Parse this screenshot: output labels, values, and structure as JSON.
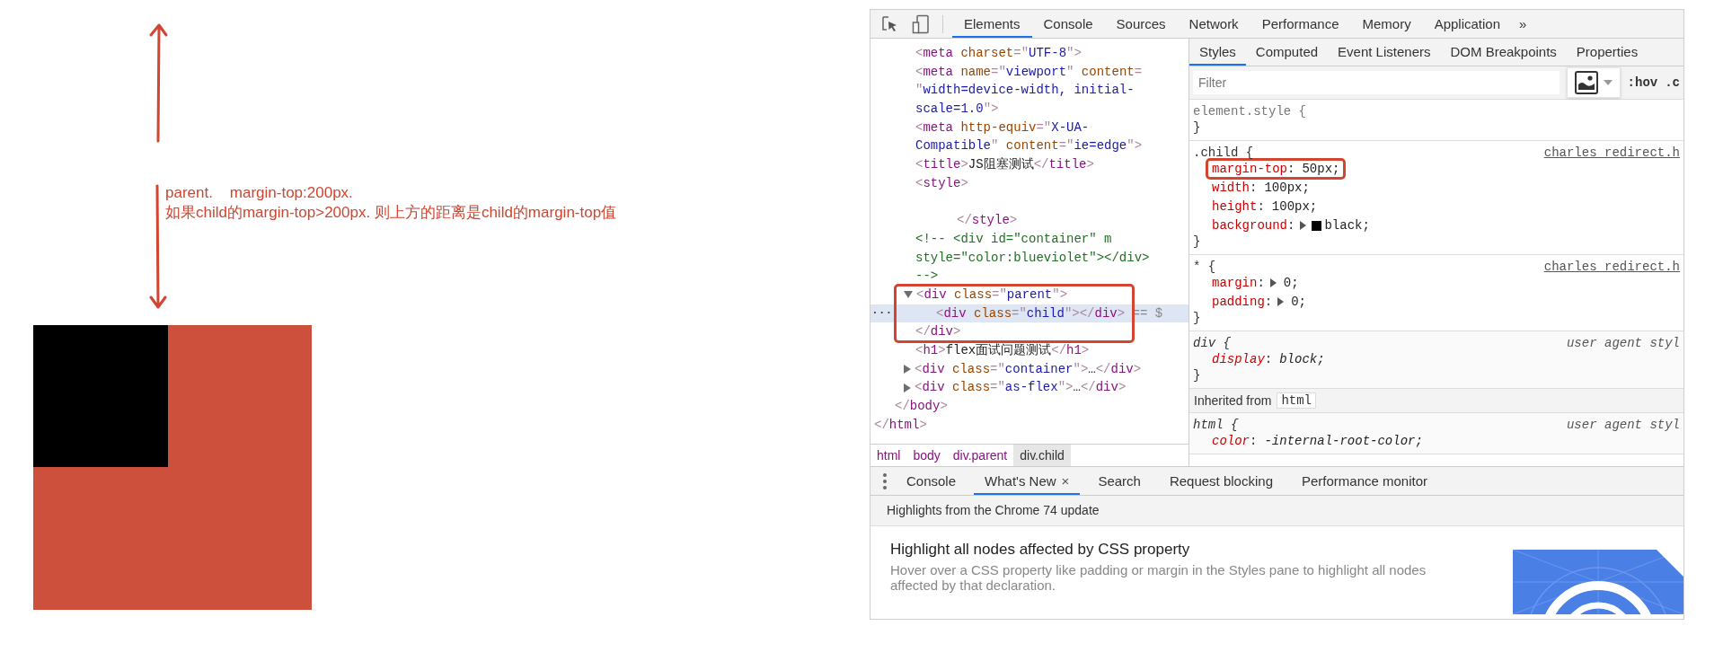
{
  "annotation": {
    "lines": [
      "parent.    margin-top:200px.",
      "如果child的margin-top>200px. 则上方的距离是child的margin-top值"
    ]
  },
  "devtools": {
    "toolbar": {
      "tabs": [
        {
          "label": "Elements",
          "selected": true
        },
        {
          "label": "Console",
          "selected": false
        },
        {
          "label": "Sources",
          "selected": false
        },
        {
          "label": "Network",
          "selected": false
        },
        {
          "label": "Performance",
          "selected": false
        },
        {
          "label": "Memory",
          "selected": false
        },
        {
          "label": "Application",
          "selected": false
        }
      ],
      "overflow": "»"
    },
    "dom_tree": [
      {
        "closing": [
          {
            "p": "</"
          },
          {
            "tag": "html"
          },
          {
            "p": ">"
          }
        ],
        "children": [
          {
            "closing": [
              {
                "p": "</"
              },
              {
                "tag": "body"
              },
              {
                "p": ">"
              }
            ],
            "children": [
              {
                "selected": false,
                "highlighted": false,
                "lines": [
                  [
                    {
                      "p": "<"
                    },
                    {
                      "tag": "meta"
                    },
                    {
                      "attr": " charset"
                    },
                    {
                      "p": "=\""
                    },
                    {
                      "val": "UTF-8"
                    },
                    {
                      "p": "\">"
                    }
                  ]
                ]
              },
              {
                "selected": false,
                "highlighted": false,
                "lines": [
                  [
                    {
                      "p": "<"
                    },
                    {
                      "tag": "meta"
                    },
                    {
                      "attr": " name"
                    },
                    {
                      "p": "=\""
                    },
                    {
                      "val": "viewport"
                    },
                    {
                      "p": "\""
                    },
                    {
                      "attr": " content"
                    },
                    {
                      "p": "="
                    }
                  ],
                  [
                    {
                      "p": "\""
                    },
                    {
                      "val": "width=device-width, initial-"
                    }
                  ],
                  [
                    {
                      "val": "scale=1.0"
                    },
                    {
                      "p": "\">"
                    }
                  ]
                ]
              },
              {
                "selected": false,
                "highlighted": false,
                "lines": [
                  [
                    {
                      "p": "<"
                    },
                    {
                      "tag": "meta"
                    },
                    {
                      "attr": " http-equiv"
                    },
                    {
                      "p": "=\""
                    },
                    {
                      "val": "X-UA-"
                    }
                  ],
                  [
                    {
                      "val": "Compatible"
                    },
                    {
                      "p": "\""
                    },
                    {
                      "attr": " content"
                    },
                    {
                      "p": "=\""
                    },
                    {
                      "val": "ie=edge"
                    },
                    {
                      "p": "\">"
                    }
                  ]
                ]
              },
              {
                "selected": false,
                "highlighted": false,
                "lines": [
                  [
                    {
                      "p": "<"
                    },
                    {
                      "tag": "title"
                    },
                    {
                      "p": ">"
                    },
                    {
                      "text": "JS阻塞测试"
                    },
                    {
                      "p": "</"
                    },
                    {
                      "tag": "title"
                    },
                    {
                      "p": ">"
                    }
                  ]
                ]
              },
              {
                "kind": "raw-text",
                "selected": false,
                "highlighted": false,
                "lines": [
                  [
                    {
                      "p": "<"
                    },
                    {
                      "tag": "style"
                    },
                    {
                      "p": ">"
                    }
                  ]
                ],
                "closing": [
                  {
                    "p": "</"
                  },
                  {
                    "tag": "style"
                  },
                  {
                    "p": ">"
                  }
                ]
              },
              {
                "kind": "comment",
                "selected": false,
                "highlighted": false,
                "lines": [
                  [
                    {
                      "c": "<!-- <div id=\"container\" m"
                    }
                  ],
                  [
                    {
                      "c": "style=\"color:blueviolet\"></div>"
                    }
                  ],
                  [
                    {
                      "c": "-->"
                    }
                  ]
                ]
              },
              {
                "selected": false,
                "highlighted": true,
                "expanded": true,
                "lines": [
                  [
                    {
                      "p": "<"
                    },
                    {
                      "tag": "div"
                    },
                    {
                      "attr": " class"
                    },
                    {
                      "p": "=\""
                    },
                    {
                      "val": "parent"
                    },
                    {
                      "p": "\">"
                    }
                  ]
                ],
                "closing": [
                  {
                    "p": "</"
                  },
                  {
                    "tag": "div"
                  },
                  {
                    "p": ">"
                  }
                ],
                "children": [
                  {
                    "selected": true,
                    "highlighted": false,
                    "gutter": "...",
                    "suffix": "== $",
                    "lines": [
                      [
                        {
                          "p": "<"
                        },
                        {
                          "tag": "div"
                        },
                        {
                          "attr": " class"
                        },
                        {
                          "p": "=\""
                        },
                        {
                          "val": "child"
                        },
                        {
                          "p": "\"></"
                        },
                        {
                          "tag": "div"
                        },
                        {
                          "p": ">"
                        }
                      ]
                    ]
                  }
                ]
              },
              {
                "selected": false,
                "highlighted": false,
                "lines": [
                  [
                    {
                      "p": "<"
                    },
                    {
                      "tag": "h1"
                    },
                    {
                      "p": ">"
                    },
                    {
                      "text": "flex面试问题测试"
                    },
                    {
                      "p": "</"
                    },
                    {
                      "tag": "h1"
                    },
                    {
                      "p": ">"
                    }
                  ]
                ]
              },
              {
                "selected": false,
                "highlighted": false,
                "expanded": false,
                "lines": [
                  [
                    {
                      "p": "<"
                    },
                    {
                      "tag": "div"
                    },
                    {
                      "attr": " class"
                    },
                    {
                      "p": "=\""
                    },
                    {
                      "val": "container"
                    },
                    {
                      "p": "\">"
                    },
                    {
                      "text": "…"
                    },
                    {
                      "p": "</"
                    },
                    {
                      "tag": "div"
                    },
                    {
                      "p": ">"
                    }
                  ]
                ]
              },
              {
                "selected": false,
                "highlighted": false,
                "expanded": false,
                "lines": [
                  [
                    {
                      "p": "<"
                    },
                    {
                      "tag": "div"
                    },
                    {
                      "attr": " class"
                    },
                    {
                      "p": "=\""
                    },
                    {
                      "val": "as-flex"
                    },
                    {
                      "p": "\">"
                    },
                    {
                      "text": "…"
                    },
                    {
                      "p": "</"
                    },
                    {
                      "tag": "div"
                    },
                    {
                      "p": ">"
                    }
                  ]
                ]
              }
            ]
          }
        ]
      }
    ],
    "breadcrumbs": [
      {
        "label": "html",
        "selected": false
      },
      {
        "label": "body",
        "selected": false
      },
      {
        "label": "div.parent",
        "selected": false
      },
      {
        "label": "div.child",
        "selected": true
      }
    ],
    "styles_tabs": [
      {
        "label": "Styles",
        "selected": true
      },
      {
        "label": "Computed",
        "selected": false
      },
      {
        "label": "Event Listeners",
        "selected": false
      },
      {
        "label": "DOM Breakpoints",
        "selected": false
      },
      {
        "label": "Properties",
        "selected": false
      }
    ],
    "filter": {
      "placeholder": "Filter",
      "hov": ":hov",
      "cls": ".c"
    },
    "rules": [
      {
        "kind": "inline",
        "selector": "element.style {",
        "close": "}"
      },
      {
        "kind": "author",
        "selector": ".child {",
        "source": "charles_redirect.h",
        "close": "}",
        "properties": [
          {
            "name": "margin-top",
            "sep": ":",
            "value": "50px;",
            "expandable": false,
            "highlighted": true
          },
          {
            "name": "width",
            "sep": ":",
            "value": "100px;",
            "expandable": false,
            "highlighted": false
          },
          {
            "name": "height",
            "sep": ":",
            "value": "100px;",
            "expandable": false,
            "highlighted": false
          },
          {
            "name": "background",
            "sep": ":",
            "value": "black;",
            "expandable": true,
            "color": "#000000",
            "highlighted": false
          }
        ]
      },
      {
        "kind": "author",
        "selector": "* {",
        "source": "charles_redirect.h",
        "close": "}",
        "properties": [
          {
            "name": "margin",
            "sep": ":",
            "value": "0;",
            "expandable": true,
            "highlighted": false
          },
          {
            "name": "padding",
            "sep": ":",
            "value": "0;",
            "expandable": true,
            "highlighted": false
          }
        ]
      },
      {
        "kind": "user-agent",
        "selector": "div {",
        "source": "user agent styl",
        "close": "}",
        "properties": [
          {
            "name": "display",
            "sep": ":",
            "value": "block;",
            "expandable": false,
            "highlighted": false
          }
        ]
      },
      {
        "kind": "inherited",
        "label": "Inherited from",
        "tag": "html"
      },
      {
        "kind": "user-agent",
        "selector": "html {",
        "source": "user agent styl",
        "properties": [
          {
            "name": "color",
            "sep": ":",
            "value": "-internal-root-color;",
            "expandable": false,
            "highlighted": false
          }
        ]
      }
    ],
    "drawer": {
      "tabs": [
        {
          "label": "Console",
          "selected": false
        },
        {
          "label": "What's New",
          "selected": true,
          "close": "×"
        },
        {
          "label": "Search",
          "selected": false
        },
        {
          "label": "Request blocking",
          "selected": false
        },
        {
          "label": "Performance monitor",
          "selected": false
        }
      ],
      "header": "Highlights from the Chrome 74 update",
      "card": {
        "title": "Highlight all nodes affected by CSS property",
        "description": "Hover over a CSS property like padding or margin in the Styles pane to highlight all nodes affected by that declaration."
      }
    }
  }
}
